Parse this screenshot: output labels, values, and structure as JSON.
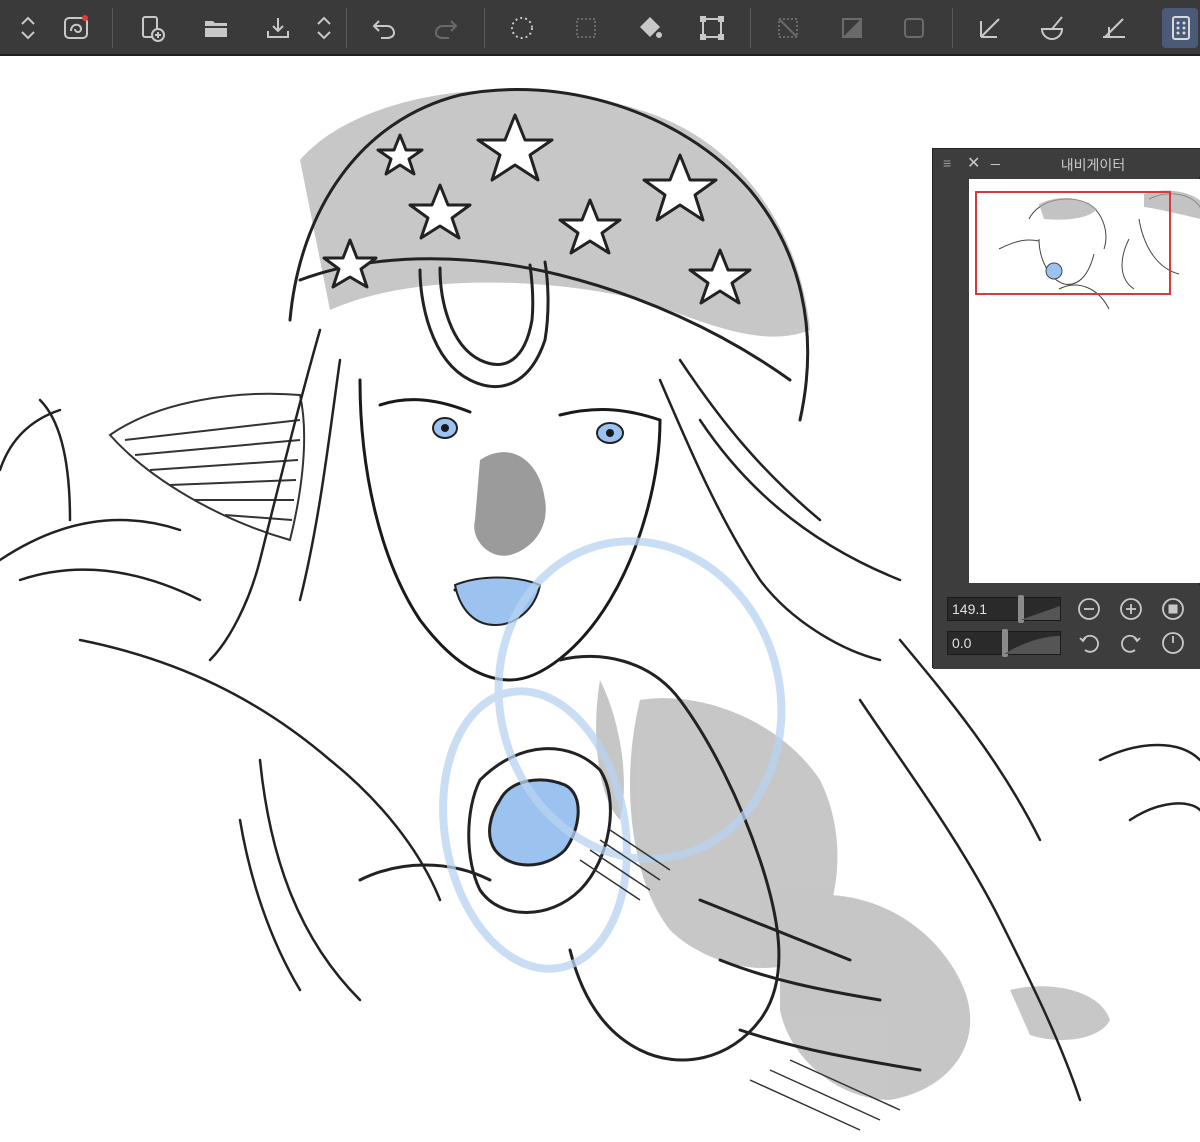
{
  "toolbar": {
    "icons": [
      "menu-toggle-icon",
      "app-logo-icon",
      "new-canvas-icon",
      "open-folder-icon",
      "save-icon",
      "scroll-arrows-icon",
      "undo-icon",
      "redo-icon",
      "lasso-select-icon",
      "deselect-icon",
      "fill-icon",
      "transform-icon",
      "clear-selection-icon",
      "invert-selection-icon",
      "select-all-icon",
      "ruler-icon",
      "brush-icon",
      "pen-icon",
      "grid-panel-icon"
    ]
  },
  "navigator": {
    "title": "내비게이터",
    "zoom_value": "149.1",
    "rotation_value": "0.0",
    "zoom_level": 149.1,
    "rotation_level": 0.0
  },
  "colors": {
    "toolbar_bg": "#3a3a3a",
    "panel_bg": "#3d3d3d",
    "accent_blue": "#9cc3f0",
    "frame_red": "#d63a3a"
  }
}
